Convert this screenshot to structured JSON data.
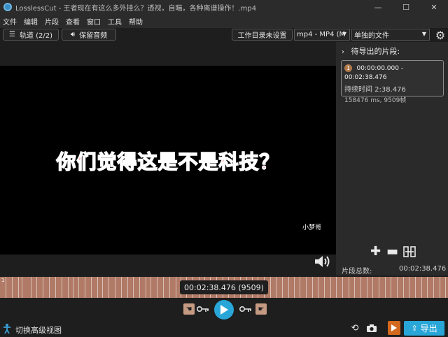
{
  "window": {
    "title": "LosslessCut - 王者现在有这么多外挂么？透视，自瞄，各种离谱操作！.mp4",
    "minimize": "—",
    "maximize": "☐",
    "close": "✕"
  },
  "menu": [
    "文件",
    "编辑",
    "片段",
    "查看",
    "窗口",
    "工具",
    "帮助"
  ],
  "toolbar": {
    "tracks_label": "轨道 (2/2)",
    "keep_audio_label": "保留音频",
    "workdir_label": "工作目录未设置",
    "format_value": "mp4 - MP4 (M",
    "output_mode_value": "单独的文件"
  },
  "video": {
    "subtitle": "你们觉得这是不是科技？",
    "watermark": "小梦哥"
  },
  "segments": {
    "header": "待导出的片段:",
    "items": [
      {
        "index": "1",
        "range": "00:00:00.000 - 00:02:38.476",
        "duration": "持续时间 2:38.476",
        "details": "158476 ms, 9509帧"
      }
    ],
    "total_label": "片段总数:",
    "total_value": "00:02:38.476"
  },
  "timeline": {
    "start_marker": "1",
    "current_time": "00:02:38.476 (9509)"
  },
  "bottom": {
    "advanced_view_label": "切换高级视图",
    "export_label": "导出"
  },
  "colors": {
    "accent": "#29a6d8",
    "timeline": "#b07a66",
    "segment_badge": "#b07a4b"
  }
}
